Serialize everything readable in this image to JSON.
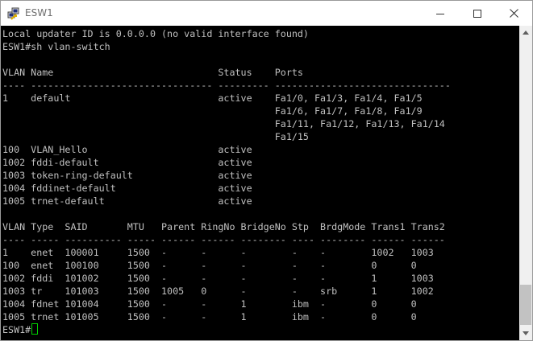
{
  "window": {
    "title": "ESW1",
    "app_icon": "putty-icon",
    "controls": {
      "minimize_icon": "minimize-icon",
      "maximize_icon": "maximize-icon",
      "close_icon": "close-icon"
    }
  },
  "terminal": {
    "text_color": "#c0c0c0",
    "background": "#000000",
    "cursor_color": "#00d000",
    "lines": [
      "Local updater ID is 0.0.0.0 (no valid interface found)",
      "ESW1#sh vlan-switch",
      "",
      "VLAN Name                             Status    Ports",
      "---- -------------------------------- --------- -------------------------------",
      "1    default                          active    Fa1/0, Fa1/3, Fa1/4, Fa1/5",
      "                                                Fa1/6, Fa1/7, Fa1/8, Fa1/9",
      "                                                Fa1/11, Fa1/12, Fa1/13, Fa1/14",
      "                                                Fa1/15",
      "100  VLAN_Hello                       active",
      "1002 fddi-default                     active",
      "1003 token-ring-default               active",
      "1004 fddinet-default                  active",
      "1005 trnet-default                    active",
      "",
      "VLAN Type  SAID       MTU   Parent RingNo BridgeNo Stp  BrdgMode Trans1 Trans2",
      "---- ----- ---------- ----- ------ ------ -------- ---- -------- ------ ------",
      "1    enet  100001     1500  -      -      -        -    -        1002   1003",
      "100  enet  100100     1500  -      -      -        -    -        0      0",
      "1002 fddi  101002     1500  -      -      -        -    -        1      1003",
      "1003 tr    101003     1500  1005   0      -        -    srb      1      1002",
      "1004 fdnet 101004     1500  -      -      1        ibm  -        0      0",
      "1005 trnet 101005     1500  -      -      1        ibm  -        0      0"
    ],
    "prompt": "ESW1#"
  },
  "scrollbar": {
    "up_icon": "scroll-up-arrow-icon",
    "down_icon": "scroll-down-arrow-icon",
    "position": 0.93
  }
}
